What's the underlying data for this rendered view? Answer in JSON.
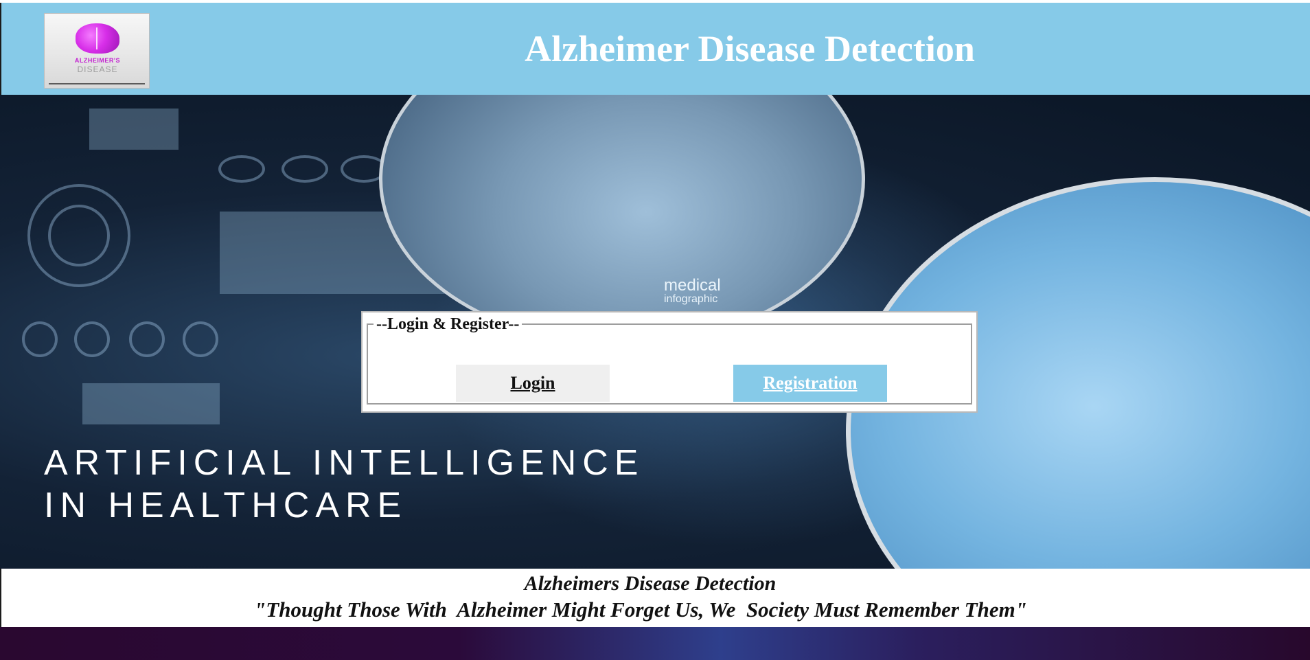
{
  "header": {
    "title": "Alzheimer Disease Detection",
    "logo": {
      "line1": "ALZHEIMER'S",
      "line2": "DISEASE"
    }
  },
  "hero": {
    "tagline_line1": "ARTIFICIAL INTELLIGENCE",
    "tagline_line2": "IN HEALTHCARE",
    "image_label_line1": "medical",
    "image_label_line2": "infographic"
  },
  "login_panel": {
    "legend": "--Login & Register--",
    "login_label": "Login",
    "register_label": "Registration"
  },
  "footer": {
    "line1": "Alzheimers Disease Detection",
    "line2": "\"Thought Those With  Alzheimer Might Forget Us, We  Society Must Remember Them\""
  },
  "colors": {
    "header_bg": "#86cae8",
    "register_button_bg": "#86cae8",
    "login_button_bg": "#efefef",
    "footer_bar": "#2b0a3a"
  }
}
